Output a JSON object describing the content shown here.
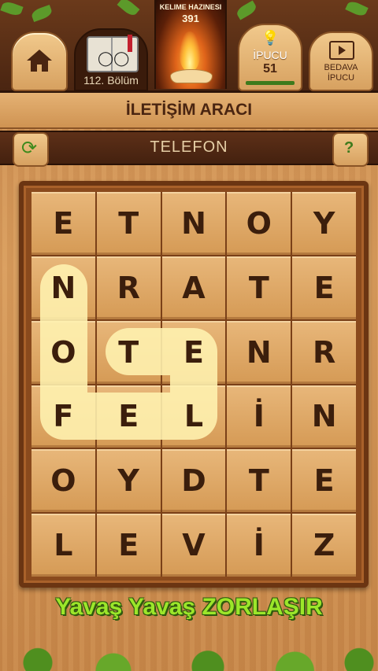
{
  "header": {
    "level_label": "112. Bölüm",
    "treasury_title": "KELIME HAZINESI",
    "treasury_value": "391",
    "hint_label": "İPUCU",
    "hint_count": "51",
    "free_hint_label_1": "BEDAVA",
    "free_hint_label_2": "İPUCU"
  },
  "category": "İLETİŞİM ARACI",
  "answer": "TELEFON",
  "help_label": "?",
  "refresh_glyph": "⟳",
  "board": {
    "rows": [
      [
        "E",
        "T",
        "N",
        "O",
        "Y"
      ],
      [
        "N",
        "R",
        "A",
        "T",
        "E"
      ],
      [
        "O",
        "T",
        "E",
        "N",
        "R"
      ],
      [
        "F",
        "E",
        "L",
        "İ",
        "N"
      ],
      [
        "O",
        "Y",
        "D",
        "T",
        "E"
      ],
      [
        "L",
        "E",
        "V",
        "İ",
        "Z"
      ]
    ]
  },
  "slogan": "Yavaş Yavaş ZORLAŞIR",
  "colors": {
    "path_highlight": "#fff3b0",
    "slogan": "#9be62a"
  }
}
